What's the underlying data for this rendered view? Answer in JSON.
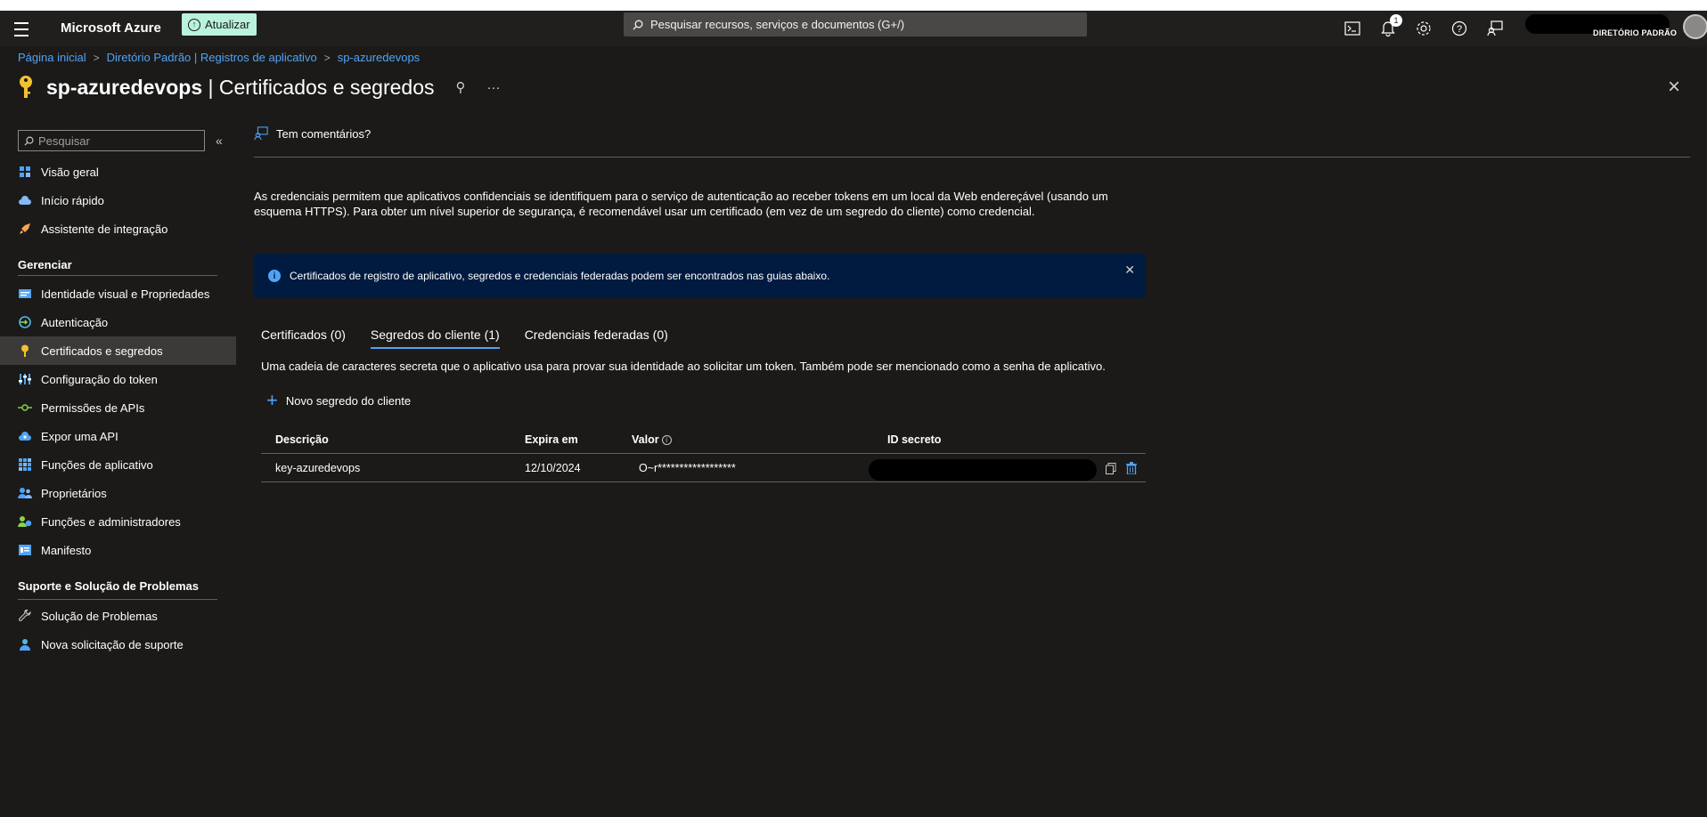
{
  "topbar": {
    "brand": "Microsoft Azure",
    "update_label": "Atualizar",
    "search_placeholder": "Pesquisar recursos, serviços e documentos (G+/)",
    "notification_count": "1",
    "directory": "DIRETÓRIO PADRÃO"
  },
  "breadcrumb": {
    "items": [
      "Página inicial",
      "Diretório Padrão | Registros de aplicativo",
      "sp-azuredevops"
    ],
    "separator": ">"
  },
  "page": {
    "title_bold": "sp-azuredevops",
    "title_rest": " | Certificados e segredos",
    "pin_glyph": "⚲",
    "more_glyph": "···",
    "close_glyph": "×"
  },
  "sidebar": {
    "search_placeholder": "Pesquisar",
    "collapse_glyph": "«",
    "items_top": [
      {
        "label": "Visão geral",
        "icon": "overview-icon"
      },
      {
        "label": "Início rápido",
        "icon": "quickstart-cloud-icon"
      },
      {
        "label": "Assistente de integração",
        "icon": "rocket-icon"
      }
    ],
    "section_manage": "Gerenciar",
    "items_manage": [
      {
        "label": "Identidade visual e Propriedades",
        "icon": "branding-icon"
      },
      {
        "label": "Autenticação",
        "icon": "authentication-icon"
      },
      {
        "label": "Certificados e segredos",
        "icon": "key-icon",
        "active": true
      },
      {
        "label": "Configuração do token",
        "icon": "token-config-icon"
      },
      {
        "label": "Permissões de APIs",
        "icon": "api-permissions-icon"
      },
      {
        "label": "Expor uma API",
        "icon": "expose-api-cloud-icon"
      },
      {
        "label": "Funções de aplicativo",
        "icon": "app-roles-icon"
      },
      {
        "label": "Proprietários",
        "icon": "owners-icon"
      },
      {
        "label": "Funções e administradores",
        "icon": "roles-admins-icon"
      },
      {
        "label": "Manifesto",
        "icon": "manifest-icon"
      }
    ],
    "section_support": "Suporte e Solução de Problemas",
    "items_support": [
      {
        "label": "Solução de Problemas",
        "icon": "wrench-icon"
      },
      {
        "label": "Nova solicitação de suporte",
        "icon": "support-person-icon"
      }
    ]
  },
  "main": {
    "feedback_label": "Tem comentários?",
    "description": "As credenciais permitem que aplicativos confidenciais se identifiquem para o serviço de autenticação ao receber tokens em um local da Web endereçável (usando um esquema HTTPS). Para obter um nível superior de segurança, é recomendável usar um certificado (em vez de um segredo do cliente) como credencial.",
    "info_message": "Certificados de registro de aplicativo, segredos e credenciais federadas podem ser encontrados nas guias abaixo.",
    "tabs": [
      {
        "label": "Certificados (0)",
        "active": false
      },
      {
        "label": "Segredos do cliente (1)",
        "active": true
      },
      {
        "label": "Credenciais federadas (0)",
        "active": false
      }
    ],
    "tab_description": "Uma cadeia de caracteres secreta que o aplicativo usa para provar sua identidade ao solicitar um token. Também pode ser mencionado como a senha de aplicativo.",
    "new_secret_label": "Novo segredo do cliente",
    "table": {
      "headers": [
        "Descrição",
        "Expira em",
        "Valor",
        "ID secreto"
      ],
      "rows": [
        {
          "description": "key-azuredevops",
          "expires": "12/10/2024",
          "value": "O~r******************",
          "secret_id": ""
        }
      ]
    }
  },
  "colors": {
    "accent": "#4fa3f7",
    "update_bg": "#b9f2dd",
    "info_bg": "#001a40",
    "active_nav": "#3b3a39"
  }
}
